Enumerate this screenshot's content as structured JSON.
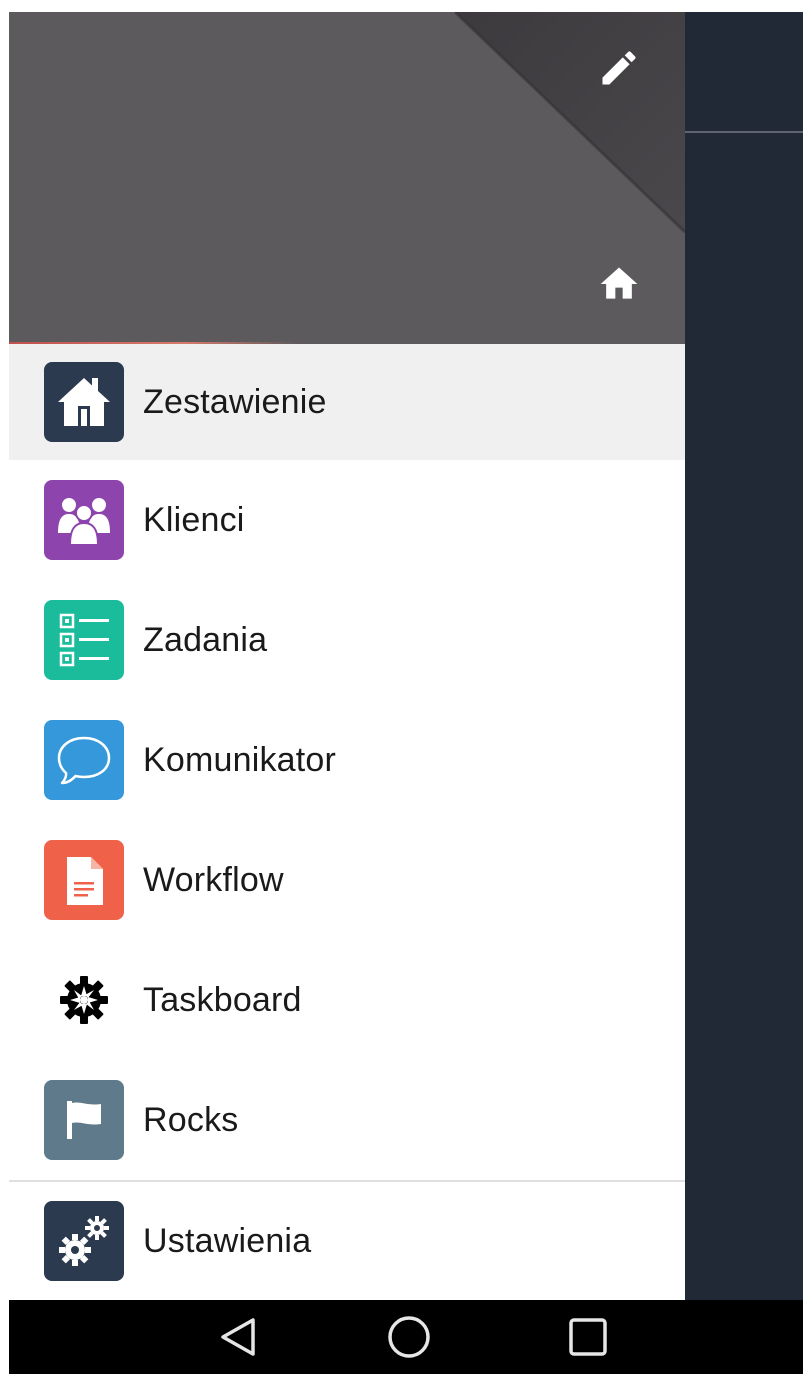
{
  "header": {
    "edit_icon": "pencil-icon",
    "home_icon": "home-icon"
  },
  "menu": {
    "items": [
      {
        "label": "Zestawienie",
        "icon": "house-icon",
        "color": "#2b3a4e",
        "active": true
      },
      {
        "label": "Klienci",
        "icon": "people-icon",
        "color": "#8e44ad"
      },
      {
        "label": "Zadania",
        "icon": "checklist-icon",
        "color": "#1abc9c"
      },
      {
        "label": "Komunikator",
        "icon": "chat-bubble-icon",
        "color": "#3498db"
      },
      {
        "label": "Workflow",
        "icon": "document-icon",
        "color": "#f0614a"
      },
      {
        "label": "Taskboard",
        "icon": "gear-icon",
        "color": "#ffffff"
      },
      {
        "label": "Rocks",
        "icon": "flag-icon",
        "color": "#5f7a8a"
      }
    ],
    "settings": {
      "label": "Ustawienia",
      "icon": "gears-icon",
      "color": "#2b3a4e"
    }
  },
  "navbar": {
    "back_icon": "back-triangle-icon",
    "home_icon": "home-circle-icon",
    "recents_icon": "recents-square-icon"
  }
}
